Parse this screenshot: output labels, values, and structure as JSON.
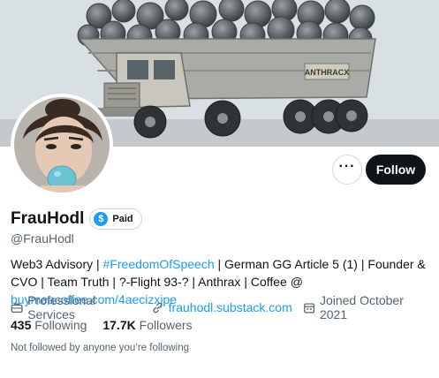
{
  "profile": {
    "display_name": "FrauHodl",
    "paid_badge": "Paid",
    "handle": "@FrauHodl",
    "bio": {
      "p1": "Web3 Advisory | ",
      "hashtag": "#FreedomOfSpeech",
      "p2": " | German GG Article 5 (1) | Founder & CVO | Team Truth | ?-Flight 93-? | Anthrax | Coffee  @ ",
      "bio_link": "buymeacoffee.com/4aecizxjpe"
    },
    "category": "Professional Services",
    "website": "frauhodl.substack.com",
    "joined": "Joined October 2021",
    "following_count": "435",
    "following_label": "Following",
    "followers_count": "17.7K",
    "followers_label": "Followers",
    "followed_note": "Not followed by anyone you’re following"
  },
  "actions": {
    "more_label": "···",
    "follow_label": "Follow"
  },
  "banner": {
    "truck_sign": "ANTHRACX"
  },
  "icons": {
    "category": "briefcase-icon",
    "website": "link-icon",
    "joined": "calendar-icon",
    "paid": "dollar-badge-icon"
  },
  "colors": {
    "accent": "#1d9bf0",
    "text": "#0f1419",
    "muted": "#536471",
    "follow_bg": "#0f1419"
  }
}
